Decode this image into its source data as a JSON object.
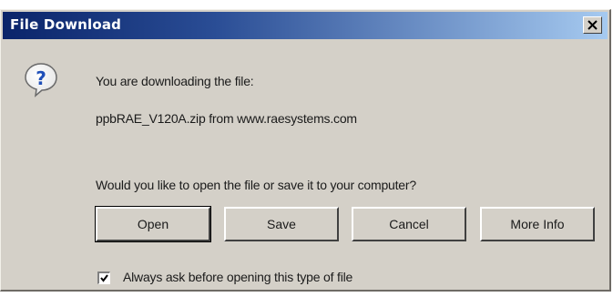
{
  "window": {
    "title": "File Download",
    "close_symbol": "×"
  },
  "content": {
    "icon": "question-icon",
    "line1": "You are downloading the file:",
    "line2": "ppbRAE_V120A.zip from www.raesystems.com",
    "line3": "Would you like to open the file or save it to your computer?"
  },
  "buttons": {
    "open": "Open",
    "save": "Save",
    "cancel": "Cancel",
    "more_info": "More Info"
  },
  "checkbox": {
    "label": "Always ask before opening this type of file",
    "checked": true
  },
  "colors": {
    "title_start": "#0a246a",
    "title_end": "#a6caf0",
    "face": "#d4d0c8",
    "icon_blue": "#1f4fb8"
  }
}
